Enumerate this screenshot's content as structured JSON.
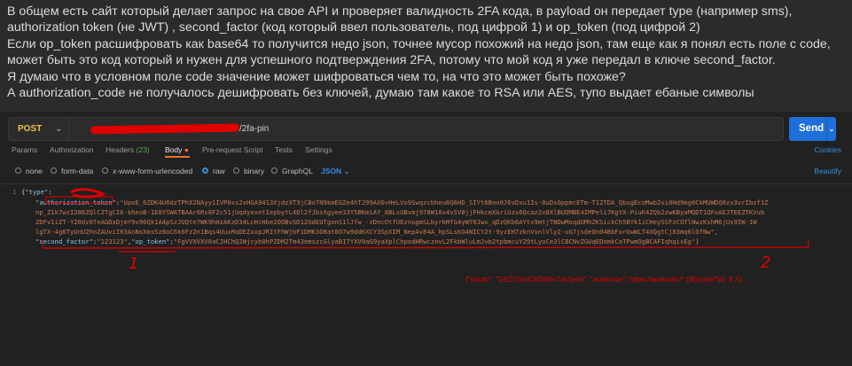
{
  "post": {
    "paragraphs": [
      "В общем есть сайт который делает запрос на свое API и проверяет валидность 2FA кода, в payload он передает type (например sms), authorization token (не JWT) , second_factor (код который ввел пользователь, под цифрой 1) и op_token (под цифрой 2)",
      "Если op_token расшифровать как base64 то получится недо json, точнее мусор похожий на недо json, там еще как я понял есть поле с code, может быть это код который и нужен для успешного подтверждения 2FA, потому что мой код я уже передал в ключе second_factor.",
      "Я думаю что в условном поле code значение может шифроваться чем то, на что это может быть похоже?",
      "А authorization_code не получалось дешифровать без ключей, думаю там какое то RSA или AES, тупо выдает ебаные символы"
    ]
  },
  "request": {
    "method": "POST",
    "url_visible": "/2fa-pin",
    "send_label": "Send"
  },
  "tabs": [
    {
      "label": "Params"
    },
    {
      "label": "Authorization"
    },
    {
      "label": "Headers",
      "count": "(23)"
    },
    {
      "label": "Body",
      "dot": "●"
    },
    {
      "label": "Pre-request Script"
    },
    {
      "label": "Tests"
    },
    {
      "label": "Settings"
    }
  ],
  "cookies_label": "Cookies",
  "body_options": [
    {
      "label": "none",
      "selected": false
    },
    {
      "label": "form-data",
      "selected": false
    },
    {
      "label": "x-www-form-urlencoded",
      "selected": false
    },
    {
      "label": "raw",
      "selected": true
    },
    {
      "label": "binary",
      "selected": false
    },
    {
      "label": "GraphQL",
      "selected": false
    }
  ],
  "format_label": "JSON",
  "beautify_label": "Beautify",
  "code": {
    "line_number": "1",
    "type_key": "\"type\"",
    "auth_key": "\"authorization_token\"",
    "auth_lines": [
      "\"UpoE_6ZDK4U6dzTPhX2NAyy1IVP0xs2xHGA9413XjdzXT3jCBo7N9kmEGZe4hTJ99AX0vHeLVo9Swqzcbheu6Q6HD_SIYt6Bno0J6vDxu1Is-0uDsGppmcETm-T12TDA_QbugEcoMwb2vi0Hd9mg0CkMUWDQ0zx3vrIbzf1Z",
      "np_Z1k7wzI286ZQlC2TgCI6-kheoB-1E8YSWATBAAr6Rs8F2c51jUqdyexetIepbytL4Dl2fJbsXgyee33Y5BKmiAY_8BLsUBvmj978W10x4vSV8jjFHkcmXAriUzs6Qcaz2x8XlBUOMBE4IMPeli7KgYX-PiuK4ZQb2zwKByaMQDT1QFoAEJTEEZTKVub",
      "ZDFv1iZT-Y20dz6TeAGDxDjmY9v96Qk1A4pSzJUQte7WK9hHzAKzD34LcHcHbe2OOBvSD12GdEUTgonS1lJfw_-zDncOtfUEznogmSLbyrkMfG4yW70Jwx_qDzQKb6AYtx9mtjTNDwMoqdUMhZKSickCh5BYk1iCHeySSFzCOTlNwzKshM6jUs9IW-1W",
      "lgTX-4g6TyUnU2hnZAUviI63AnNsXmsSz8oC6k6Fz2n1Bqs4UuxMaDEZxxpJRItFhWjbF1DMK3O8at0O7w9ddKXCY3SpXIM_NepAv84A_hpSLsKG4NICY2t-9yzEH7zknVxnlVly2-uG7jsdeOn04BbFxrUwWLT4XQgtCj83mq6lOfNw\","
    ],
    "sf_key": "\"second_factor\"",
    "sf_value": "\"123123\"",
    "op_key": "\"op_token\"",
    "op_value": "\"FgVVXVXV0aCJHChQ2Wjcyb0hPZDM2Tm43emszcGlyaBI7YXV0aG9yaXplChpodHRwczovL2FkbWluLmJvb2tpbmcuY29tLyoCe3lCBCNvZGUqEDomkCaTPwmOgBCAFIqhqixEg\"}"
  },
  "annotations": {
    "num1": "1",
    "num2": "2",
    "decoded": "{\"oauth\": \"G6Z72oHOd36Nn7zk3pirh\", \"authorize\": https://мойсайт/* ()B{code\"b0; 8 X}"
  },
  "colors": {
    "accent": "#1f6fd8",
    "active_tab": "#e8702a",
    "link": "#2f8ee0",
    "annotation": "#e00000"
  }
}
